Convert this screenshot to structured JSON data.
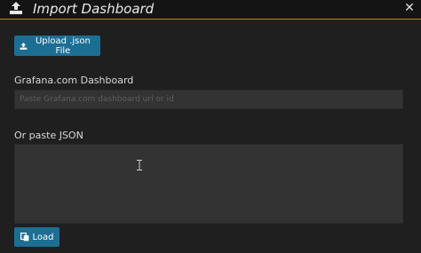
{
  "header": {
    "title": "Import Dashboard",
    "close_symbol": "✕",
    "icon": "upload-icon",
    "accent_color": "#c47d25"
  },
  "upload": {
    "label": "Upload .json File",
    "icon": "upload-icon"
  },
  "grafana_com": {
    "label": "Grafana.com Dashboard",
    "placeholder": "Paste Grafana.com dashboard url or id",
    "value": ""
  },
  "json": {
    "label": "Or paste JSON",
    "value": ""
  },
  "load": {
    "label": "Load",
    "icon": "copy-icon"
  },
  "colors": {
    "button": "#1d6e93",
    "background": "#1f1f20",
    "input": "#333334"
  }
}
